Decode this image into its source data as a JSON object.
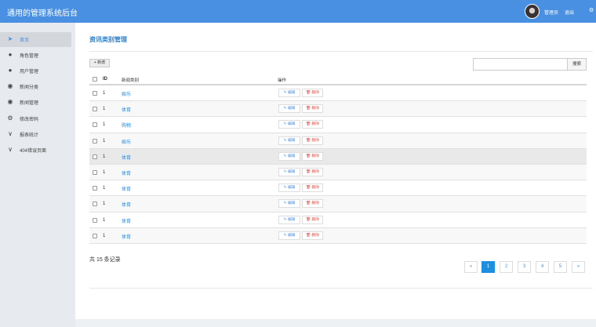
{
  "app": {
    "title": "通用的管理系统后台",
    "user_name": "管理员",
    "logout_label": "退出"
  },
  "sidebar": {
    "items": [
      {
        "label": "首页",
        "icon": "send-icon"
      },
      {
        "label": "角色管理",
        "icon": "user-icon"
      },
      {
        "label": "用户管理",
        "icon": "user-icon"
      },
      {
        "label": "新闻分类",
        "icon": "chat-icon"
      },
      {
        "label": "新闻管理",
        "icon": "chat-icon"
      },
      {
        "label": "修改密码",
        "icon": "gear-icon"
      },
      {
        "label": "报表统计",
        "icon": "chevron-down-icon"
      },
      {
        "label": "404错误页面",
        "icon": "chevron-down-icon"
      }
    ]
  },
  "page": {
    "title": "资讯类别管理",
    "add_label": "+ 新增",
    "search_placeholder": "",
    "search_label": "搜索"
  },
  "table": {
    "headers": {
      "id": "ID",
      "category": "新闻类别",
      "ops": "操作"
    },
    "edit_label": "✎ 编辑",
    "delete_label": "🗑 删除",
    "rows": [
      {
        "id": "1",
        "category": "娱乐"
      },
      {
        "id": "1",
        "category": "体育"
      },
      {
        "id": "1",
        "category": "购物"
      },
      {
        "id": "1",
        "category": "娱乐"
      },
      {
        "id": "1",
        "category": "体育"
      },
      {
        "id": "1",
        "category": "体育"
      },
      {
        "id": "1",
        "category": "体育"
      },
      {
        "id": "1",
        "category": "体育"
      },
      {
        "id": "1",
        "category": "体育"
      },
      {
        "id": "1",
        "category": "体育"
      }
    ]
  },
  "footer": {
    "total_text": "共 15 条记录"
  },
  "pagination": {
    "prev": "«",
    "pages": [
      "1",
      "2",
      "3",
      "4",
      "5"
    ],
    "next": "»",
    "current": "1"
  },
  "colors": {
    "header_bg": "#4a90e2",
    "accent": "#2b8ad8",
    "danger": "#d9534f",
    "active_page": "#1e8fde"
  }
}
